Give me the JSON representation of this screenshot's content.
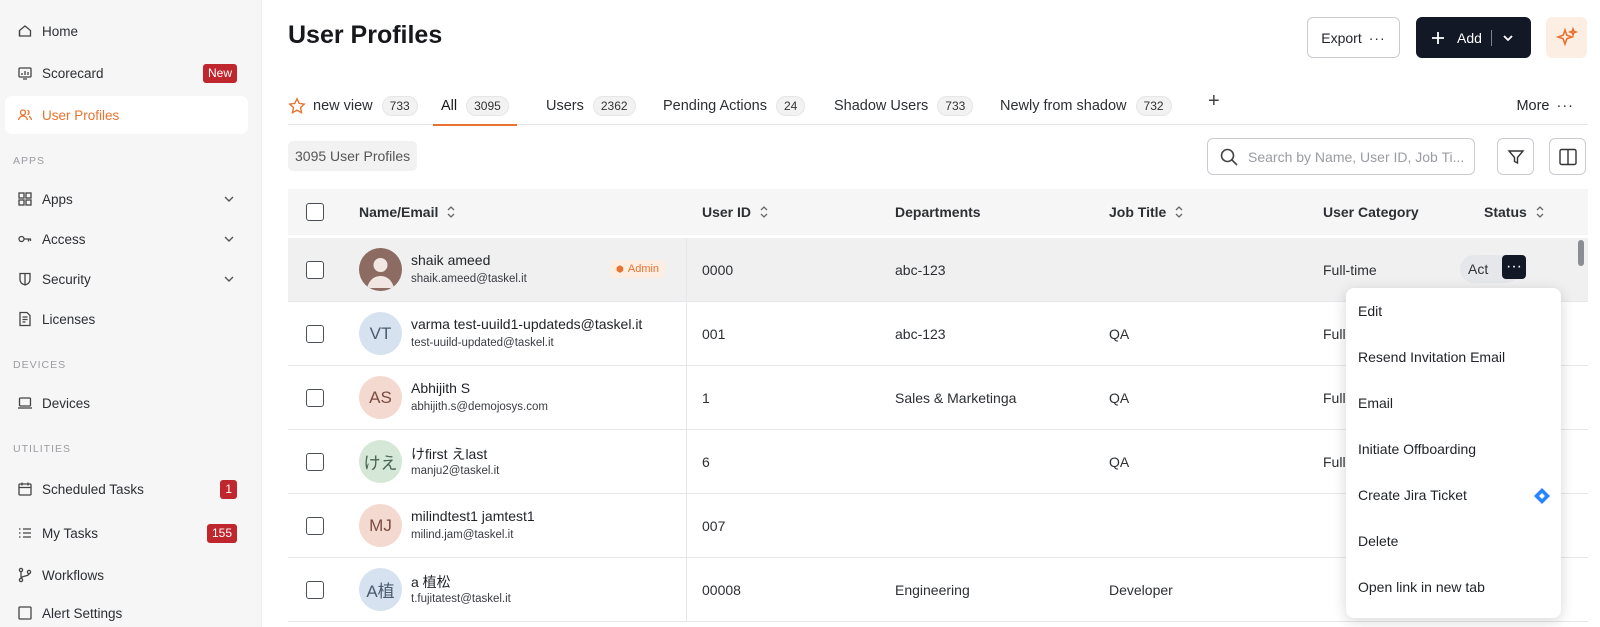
{
  "sidebar": {
    "items": [
      {
        "label": "Home",
        "icon": "home-icon"
      },
      {
        "label": "Scorecard",
        "icon": "scorecard-icon",
        "badge": "New"
      },
      {
        "label": "User Profiles",
        "icon": "users-icon",
        "active": true
      },
      {
        "label": "Apps",
        "icon": "grid-icon"
      },
      {
        "label": "Access",
        "icon": "key-icon"
      },
      {
        "label": "Security",
        "icon": "shield-icon"
      },
      {
        "label": "Licenses",
        "icon": "license-icon"
      },
      {
        "label": "Devices",
        "icon": "laptop-icon"
      },
      {
        "label": "Scheduled Tasks",
        "icon": "calendar-icon",
        "badge": "1"
      },
      {
        "label": "My Tasks",
        "icon": "tasks-icon",
        "badge": "155"
      },
      {
        "label": "Workflows",
        "icon": "workflow-icon"
      },
      {
        "label": "Alert Settings",
        "icon": "alert-icon"
      }
    ],
    "sections": {
      "apps": "APPS",
      "devices": "DEVICES",
      "utilities": "UTILITIES"
    }
  },
  "header": {
    "title": "User Profiles",
    "export_label": "Export",
    "export_dots": "···",
    "add_label": "Add"
  },
  "tabs": [
    {
      "label": "new view",
      "count": "733"
    },
    {
      "label": "All",
      "count": "3095",
      "active": true
    },
    {
      "label": "Users",
      "count": "2362"
    },
    {
      "label": "Pending Actions",
      "count": "24"
    },
    {
      "label": "Shadow Users",
      "count": "733"
    },
    {
      "label": "Newly from shadow",
      "count": "732"
    }
  ],
  "tab_plus": "+",
  "more_label": "More",
  "more_dots": "···",
  "toolbar": {
    "count_label": "3095 User Profiles",
    "search_placeholder": "Search by Name, User ID, Job Ti..."
  },
  "table": {
    "columns": [
      "Name/Email",
      "User ID",
      "Departments",
      "Job Title",
      "User Category",
      "Status"
    ],
    "rows": [
      {
        "initials": "",
        "name": "shaik ameed",
        "email": "shaik.ameed@taskel.it",
        "admin": "Admin",
        "user_id": "0000",
        "department": "abc-123",
        "job_title": "",
        "category": "Full-time",
        "status": "Act"
      },
      {
        "initials": "VT",
        "name": "varma test-uuild1-updateds@taskel.it",
        "email": "test-uuild-updated@taskel.it",
        "user_id": "001",
        "department": "abc-123",
        "job_title": "QA",
        "category": "Full"
      },
      {
        "initials": "AS",
        "name": "Abhijith S",
        "email": "abhijith.s@demojosys.com",
        "user_id": "1",
        "department": "Sales & Marketinga",
        "job_title": "QA",
        "category": "Full"
      },
      {
        "initials": "けえ",
        "name": "けfirst えlast",
        "email": "manju2@taskel.it",
        "user_id": "6",
        "department": "",
        "job_title": "QA",
        "category": "Full"
      },
      {
        "initials": "MJ",
        "name": "milindtest1 jamtest1",
        "email": "milind.jam@taskel.it",
        "user_id": "007",
        "department": "",
        "job_title": "",
        "category": ""
      },
      {
        "initials": "A植",
        "name": "a 植松",
        "email": "t.fujitatest@taskel.it",
        "user_id": "00008",
        "department": "Engineering",
        "job_title": "Developer",
        "category": ""
      }
    ]
  },
  "row_menu": {
    "dots": "···",
    "items": [
      "Edit",
      "Resend Invitation Email",
      "Email",
      "Initiate Offboarding",
      "Create Jira Ticket",
      "Delete",
      "Open link in new tab"
    ]
  },
  "colors": {
    "accent": "#e8722f",
    "dark": "#121826",
    "badge_red": "#c0262d",
    "jira": "#2684ff"
  }
}
